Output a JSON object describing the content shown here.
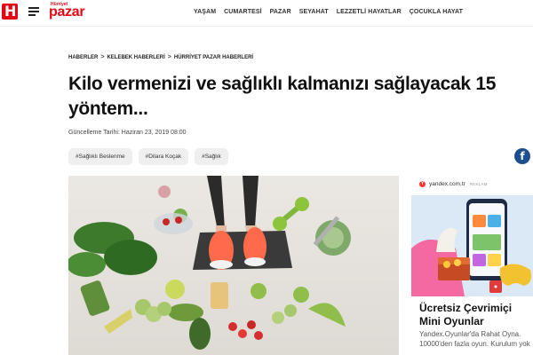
{
  "header": {
    "logo_letter": "H",
    "brand_small": "Hürriyet",
    "brand": "pazar",
    "nav": [
      "YAŞAM",
      "CUMARTESİ",
      "PAZAR",
      "SEYAHAT",
      "LEZZETLİ HAYATLAR",
      "ÇOCUKLA HAYAT"
    ]
  },
  "breadcrumb": {
    "items": [
      "HABERLER",
      "KELEBEK HABERLERİ",
      "HÜRRİYET PAZAR HABERLERİ"
    ],
    "separator": ">"
  },
  "article": {
    "title": "Kilo vermenizi ve sağlıklı kalmanızı sağlayacak 15 yöntem...",
    "date": "Güncelleme Tarihi: Haziran 23, 2019 08:00",
    "tags": [
      "#Sağlıklı Beslenme",
      "#Dilara Koçak",
      "#Sağlık"
    ],
    "share_icon": "facebook-icon"
  },
  "ad": {
    "domain": "yandex.com.tr",
    "label": "REKLAM",
    "title": "Ücretsiz Çevrimiçi Mini Oyunlar",
    "desc": "Yandex.Oyunlar'da Rahat Oyna. 10000'den fazla oyun. Kurulum yok"
  },
  "colors": {
    "brand_red": "#e30613",
    "facebook_blue": "#1b4f8d",
    "tag_bg": "#efefef"
  }
}
